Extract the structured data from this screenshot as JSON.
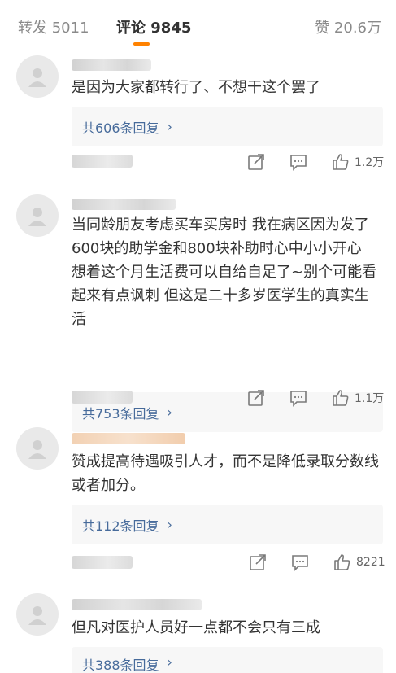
{
  "tabs": {
    "repost": "转发 5011",
    "comment": "评论 9845",
    "like": "赞 20.6万"
  },
  "comments": [
    {
      "text": "是因为大家都转行了、不想干这个罢了",
      "replies": "共606条回复",
      "likes": "1.2万"
    },
    {
      "text": "当同龄朋友考虑买车买房时 我在病区因为发了600块的助学金和800块补助时心中小小开心 想着这个月生活费可以自给自足了~别个可能看起来有点讽刺 但这是二十多岁医学生的真实生活",
      "replies": "共753条回复",
      "likes": "1.1万"
    },
    {
      "text": "赞成提高待遇吸引人才，而不是降低录取分数线或者加分。",
      "replies": "共112条回复",
      "likes": "8221"
    },
    {
      "text": "但凡对医护人员好一点都不会只有三成",
      "replies": "共388条回复",
      "likes": ""
    }
  ],
  "colors": {
    "accent": "#ff8200",
    "link": "#476b9b"
  }
}
